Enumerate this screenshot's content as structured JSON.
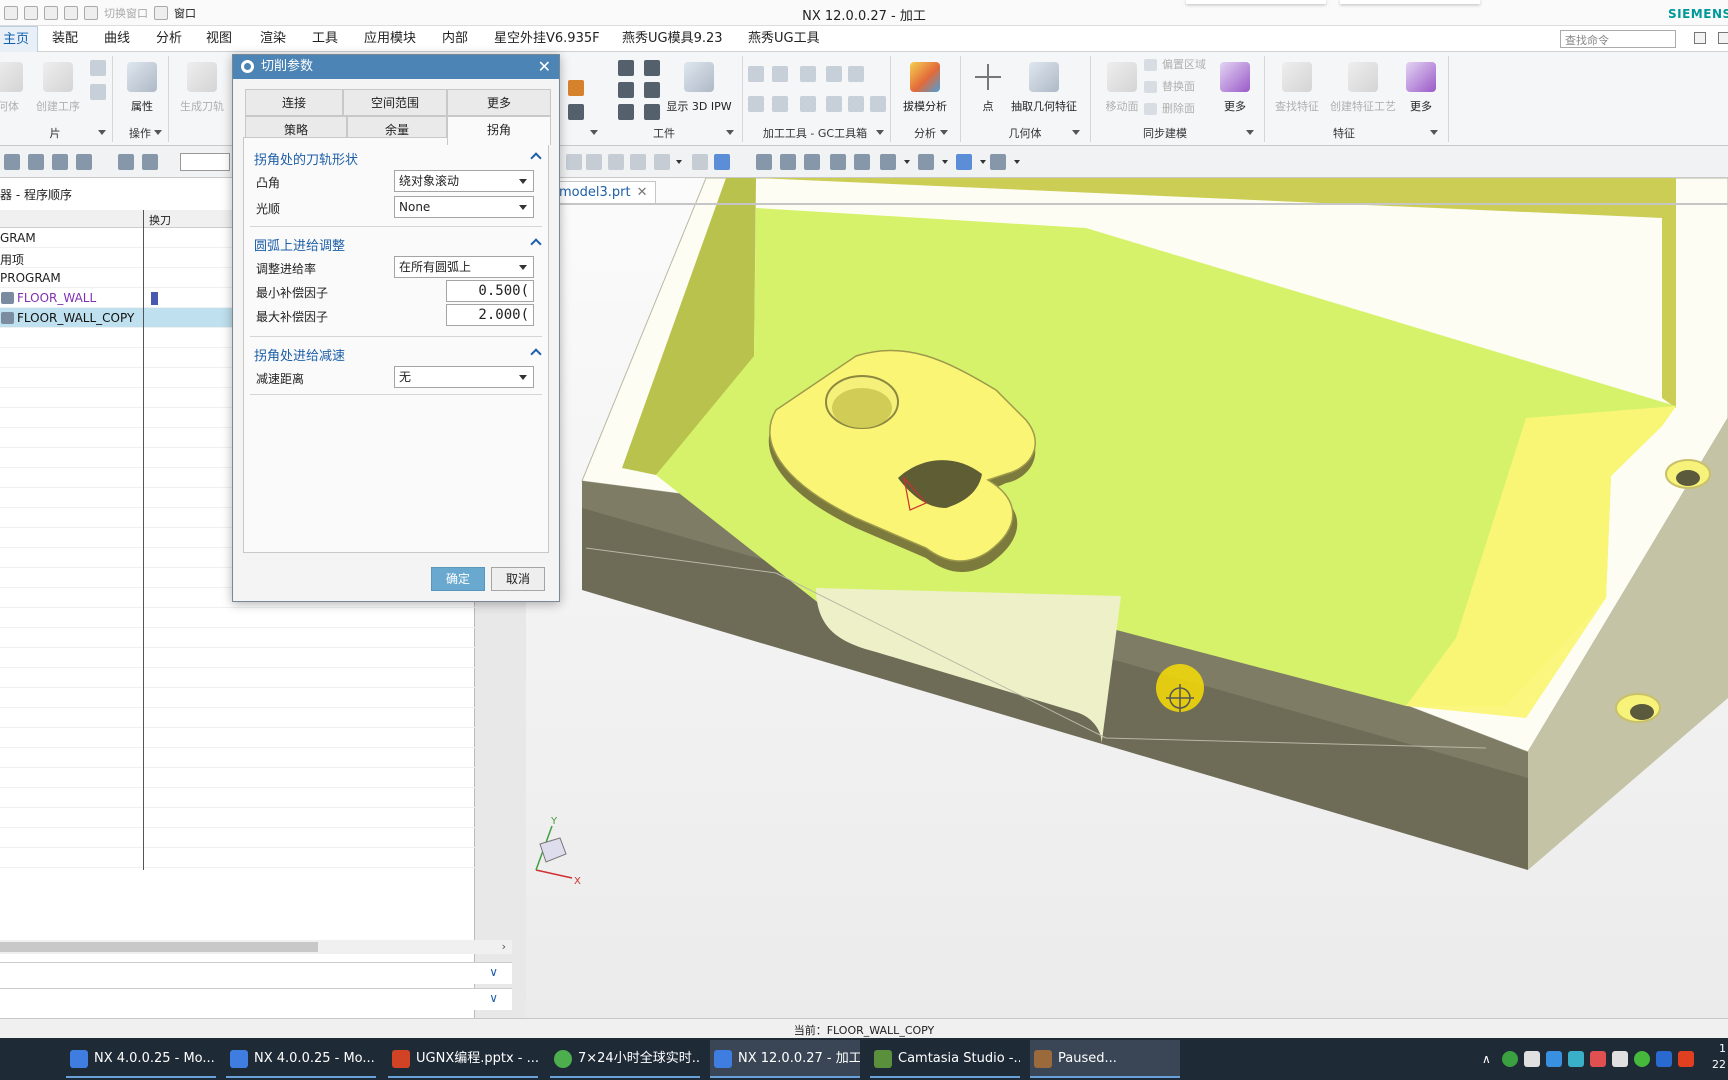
{
  "window": {
    "title": "NX 12.0.0.27 - 加工",
    "brand": "SIEMENS",
    "quick_access": {
      "switch_window": "切换窗口",
      "window": "窗口"
    }
  },
  "menu": {
    "tabs": [
      "主页",
      "装配",
      "曲线",
      "分析",
      "视图",
      "渲染",
      "工具",
      "应用模块",
      "内部",
      "星空外挂V6.935F",
      "燕秀UG模具9.23",
      "燕秀UG工具"
    ],
    "active_tab": "主页",
    "search_placeholder": "查找命令"
  },
  "ribbon": {
    "left_buttons": {
      "geometry": "何体",
      "create_operation": "创建工序",
      "properties": "属性",
      "generate_path": "生成刀轨"
    },
    "left_groups": {
      "part": "片",
      "operations": "操作"
    },
    "display_3d_ipw": "显示 3D IPW",
    "draft_analysis": "拔模分析",
    "point": "点",
    "extract_geometry": "抽取几何特征",
    "move_face": "移动面",
    "offset_region": "偏置区域",
    "replace_face": "替换面",
    "delete_face": "删除面",
    "more": "更多",
    "find_feature": "查找特征",
    "create_feature_process": "创建特征工艺",
    "groups": {
      "workpiece": "工件",
      "gc_tools": "加工工具 - GC工具箱",
      "analysis": "分析",
      "geometry": "几何体",
      "sync_modeling": "同步建模",
      "feature": "特征"
    }
  },
  "navigator": {
    "title": "器 - 程序顺序",
    "col_tool_change": "换刀",
    "rows": [
      {
        "label": "GRAM",
        "type": "program"
      },
      {
        "label": "用项",
        "type": "program"
      },
      {
        "label": "PROGRAM",
        "type": "program"
      },
      {
        "label": "FLOOR_WALL",
        "type": "operation"
      },
      {
        "label": "FLOOR_WALL_COPY",
        "type": "operation",
        "selected": true
      }
    ]
  },
  "document_tab": {
    "label": "model3.prt"
  },
  "dialog": {
    "title": "切削参数",
    "tabs_row1": [
      "连接",
      "空间范围",
      "更多"
    ],
    "tabs_row2": [
      "策略",
      "余量",
      "拐角"
    ],
    "active_tab": "拐角",
    "sections": [
      {
        "title": "拐角处的刀轨形状",
        "fields": [
          {
            "label": "凸角",
            "value": "绕对象滚动",
            "type": "dropdown"
          },
          {
            "label": "光顺",
            "value": "None",
            "type": "dropdown"
          }
        ]
      },
      {
        "title": "圆弧上进给调整",
        "fields": [
          {
            "label": "调整进给率",
            "value": "在所有圆弧上",
            "type": "dropdown"
          },
          {
            "label": "最小补偿因子",
            "value": "0.500(",
            "type": "number"
          },
          {
            "label": "最大补偿因子",
            "value": "2.000(",
            "type": "number"
          }
        ]
      },
      {
        "title": "拐角处进给减速",
        "fields": [
          {
            "label": "减速距离",
            "value": "无",
            "type": "dropdown"
          }
        ]
      }
    ],
    "ok": "确定",
    "cancel": "取消"
  },
  "triad": {
    "x": "X",
    "y": "Y"
  },
  "status": {
    "text": "当前：FLOOR_WALL_COPY"
  },
  "taskbar": {
    "items": [
      "NX 4.0.0.25 - Mo...",
      "NX 4.0.0.25 - Mo...",
      "UGNX编程.pptx - ...",
      "7×24小时全球实时...",
      "NX 12.0.0.27 - 加工",
      "Camtasia Studio -...",
      "Paused..."
    ],
    "clock": "1\n22"
  },
  "colors": {
    "accent": "#4b84b5",
    "floor_green": "#d6f26a",
    "boss_yellow": "#fbf576",
    "selected_row": "#bfe0ee",
    "operation_text": "#7f30b0"
  }
}
